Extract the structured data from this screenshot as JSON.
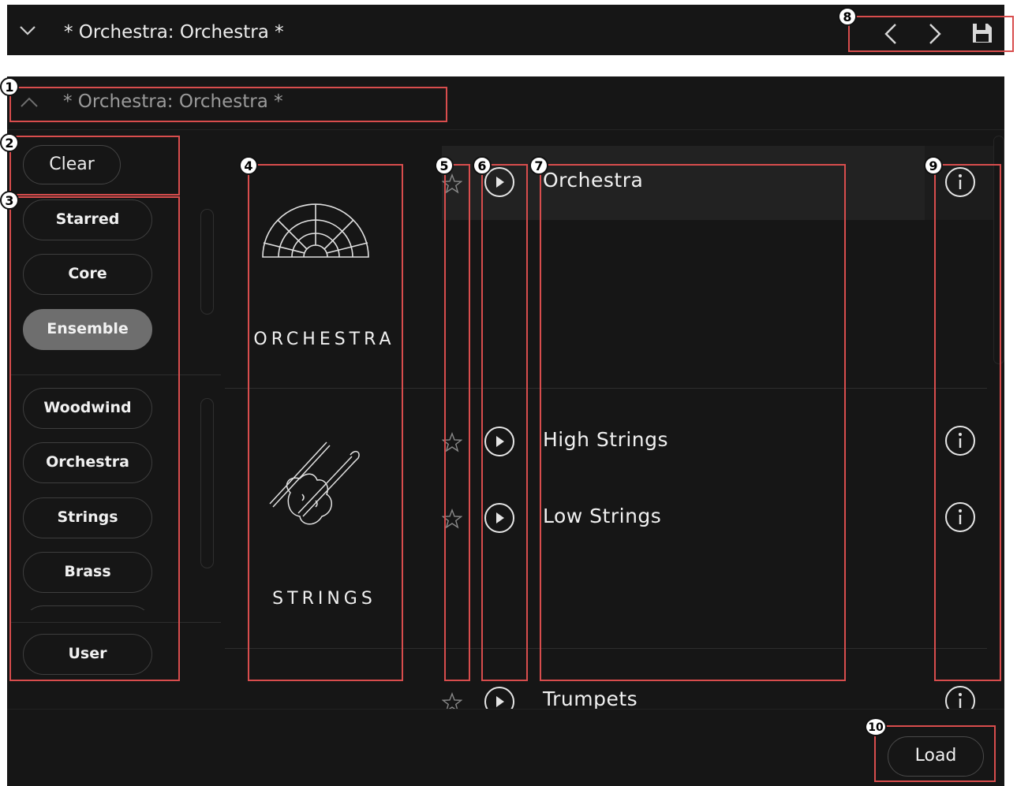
{
  "topbar": {
    "title": "* Orchestra: Orchestra *",
    "chevron_icon": "chevron-down-icon",
    "nav_icons": [
      "chevron-left-icon",
      "chevron-right-icon",
      "save-icon"
    ]
  },
  "browser": {
    "title": "* Orchestra: Orchestra *",
    "collapse_icon": "chevron-up-icon",
    "clear_label": "Clear",
    "filters_group1": [
      {
        "label": "Starred",
        "active": false
      },
      {
        "label": "Core",
        "active": false
      },
      {
        "label": "Ensemble",
        "active": true
      }
    ],
    "filters_group2": [
      {
        "label": "Woodwind"
      },
      {
        "label": "Orchestra"
      },
      {
        "label": "Strings"
      },
      {
        "label": "Brass"
      }
    ],
    "user_label": "User",
    "categories": [
      {
        "label": "ORCHESTRA",
        "icon": "orchestra-fan-icon"
      },
      {
        "label": "STRINGS",
        "icon": "violin-icon"
      }
    ],
    "presets": [
      {
        "name": "Orchestra",
        "selected": true
      },
      {
        "name": "High Strings",
        "selected": false
      },
      {
        "name": "Low Strings",
        "selected": false
      },
      {
        "name": "Trumpets",
        "selected": false
      }
    ],
    "load_label": "Load"
  },
  "annotations": [
    "1",
    "2",
    "3",
    "4",
    "5",
    "6",
    "7",
    "8",
    "9",
    "10"
  ],
  "colors": {
    "background": "#161616",
    "selected_row": "#222222",
    "active_pill": "#6e6e6e",
    "annotation": "#d84d4d"
  }
}
